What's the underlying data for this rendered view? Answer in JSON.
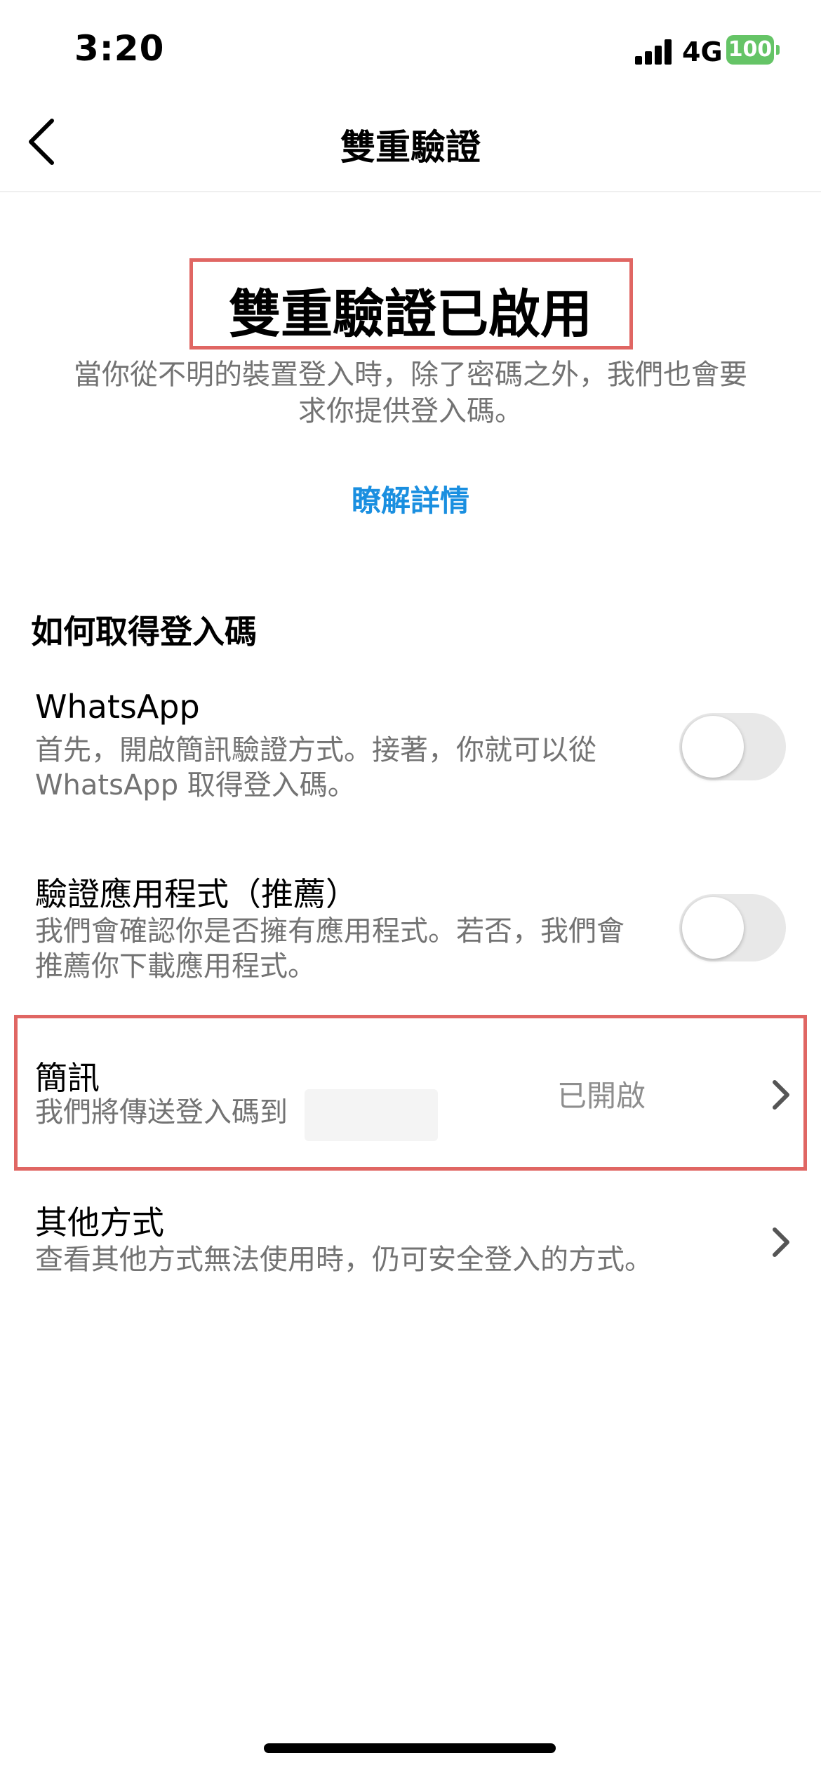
{
  "status_bar": {
    "time": "3:20",
    "network": "4G",
    "battery": "100"
  },
  "nav": {
    "title": "雙重驗證",
    "back_icon": "chevron-left-icon"
  },
  "hero": {
    "headline": "雙重驗證已啟用",
    "description": "當你從不明的裝置登入時，除了密碼之外，我們也會要求你提供登入碼。",
    "learn_more": "瞭解詳情"
  },
  "section": {
    "title": "如何取得登入碼"
  },
  "methods": [
    {
      "title": "WhatsApp",
      "subtitle": "首先，開啟簡訊驗證方式。接著，你就可以從WhatsApp 取得登入碼。",
      "enabled": false
    },
    {
      "title": "驗證應用程式（推薦）",
      "subtitle": "我們會確認你是否擁有應用程式。若否，我們會推薦你下載應用程式。",
      "enabled": false
    },
    {
      "title": "簡訊",
      "subtitle_prefix": "我們將傳送登入碼到",
      "subtitle_suffix": "。",
      "status": "已開啟"
    },
    {
      "title": "其他方式",
      "subtitle": "查看其他方式無法使用時，仍可安全登入的方式。"
    }
  ],
  "colors": {
    "link": "#1a8fe0",
    "highlight": "#e06663",
    "battery": "#65c466"
  }
}
